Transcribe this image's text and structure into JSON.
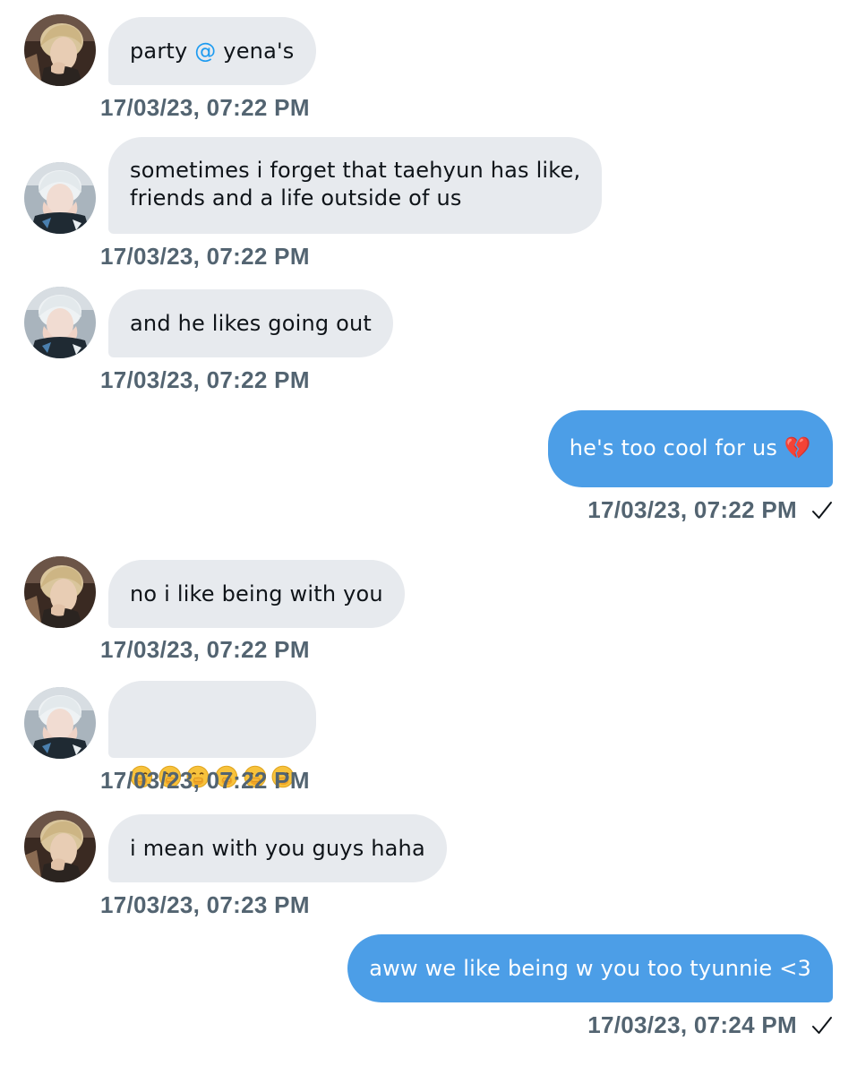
{
  "conversation": {
    "messages": [
      {
        "sender": "them",
        "avatar_icon": "avatar-photo-blonde-icon",
        "text_before": "party ",
        "mention": "@",
        "text_after": " yena's",
        "timestamp": "17/03/23, 07:22 PM"
      },
      {
        "sender": "them",
        "avatar_icon": "avatar-photo-silver-icon",
        "text": "sometimes i forget that taehyun has like,\nfriends and a life outside of us",
        "timestamp": "17/03/23, 07:22 PM"
      },
      {
        "sender": "them",
        "avatar_icon": "avatar-photo-silver-icon",
        "text": "and he likes going out",
        "timestamp": "17/03/23, 07:22 PM"
      },
      {
        "sender": "me",
        "text": "he's too cool for us 💔",
        "timestamp": "17/03/23, 07:22 PM",
        "read_icon": "checkmark-icon"
      },
      {
        "sender": "them",
        "avatar_icon": "avatar-photo-blonde-icon",
        "text": "no i like being with you",
        "timestamp": "17/03/23, 07:22 PM"
      },
      {
        "sender": "them",
        "avatar_icon": "avatar-photo-silver-icon",
        "emoji_icons": [
          "hand-over-mouth-emoji-icon",
          "hand-over-mouth-emoji-icon",
          "hand-over-mouth-emoji-icon",
          "hand-over-mouth-emoji-icon",
          "hand-over-mouth-emoji-icon",
          "hand-over-mouth-emoji-icon"
        ],
        "timestamp": "17/03/23, 07:22 PM"
      },
      {
        "sender": "them",
        "avatar_icon": "avatar-photo-blonde-icon",
        "text": "i mean with you guys haha",
        "timestamp": "17/03/23, 07:23 PM"
      },
      {
        "sender": "me",
        "text": "aww we like being w you too tyunnie <3",
        "timestamp": "17/03/23, 07:24 PM",
        "read_icon": "checkmark-icon"
      }
    ]
  },
  "colors": {
    "incoming_bubble": "#e7eaee",
    "outgoing_bubble": "#4c9ee7",
    "timestamp": "#536471",
    "mention": "#1d9bf0"
  }
}
